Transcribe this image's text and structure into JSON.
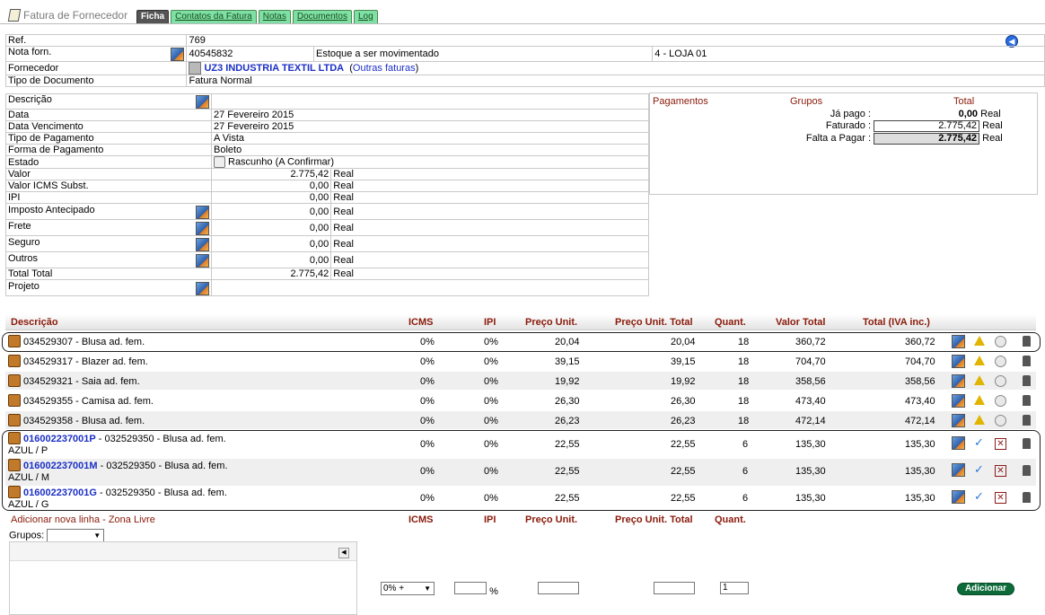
{
  "header": {
    "title": "Fatura de Fornecedor"
  },
  "tabs": [
    {
      "label": "Ficha",
      "active": true
    },
    {
      "label": "Contatos da Fatura",
      "active": false
    },
    {
      "label": "Notas",
      "active": false
    },
    {
      "label": "Documentos",
      "active": false
    },
    {
      "label": "Log",
      "active": false
    }
  ],
  "ficha": {
    "ref_label": "Ref.",
    "ref_value": "769",
    "nota_label": "Nota forn.",
    "nota_value": "40545832",
    "estoque_label": "Estoque a ser movimentado",
    "estoque_value": "4 - LOJA 01",
    "fornecedor_label": "Fornecedor",
    "fornecedor_name": "UZ3 INDUSTRIA TEXTIL LTDA",
    "fornecedor_link": "Outras faturas",
    "tipo_doc_label": "Tipo de Documento",
    "tipo_doc_value": "Fatura Normal",
    "descricao_label": "Descrição",
    "data_label": "Data",
    "data_value": "27 Fevereiro 2015",
    "venc_label": "Data Vencimento",
    "venc_value": "27 Fevereiro 2015",
    "tipo_pag_label": "Tipo de Pagamento",
    "tipo_pag_value": "A Vista",
    "forma_pag_label": "Forma de Pagamento",
    "forma_pag_value": "Boleto",
    "estado_label": "Estado",
    "estado_value": "Rascunho (A Confirmar)",
    "valor_label": "Valor",
    "valor_value": "2.775,42",
    "icms_label": "Valor ICMS Subst.",
    "icms_value": "0,00",
    "ipi_label": "IPI",
    "ipi_value": "0,00",
    "imposto_label": "Imposto Antecipado",
    "imposto_value": "0,00",
    "frete_label": "Frete",
    "frete_value": "0,00",
    "seguro_label": "Seguro",
    "seguro_value": "0,00",
    "outros_label": "Outros",
    "outros_value": "0,00",
    "total_label": "Total Total",
    "total_value": "2.775,42",
    "projeto_label": "Projeto",
    "currency": "Real"
  },
  "payments": {
    "col1": "Pagamentos",
    "col2": "Grupos",
    "col3": "Total",
    "ja_pago_label": "Já pago :",
    "ja_pago_value": "0,00",
    "faturado_label": "Faturado :",
    "faturado_value": "2.775,42",
    "falta_label": "Falta a Pagar :",
    "falta_value": "2.775,42",
    "currency": "Real"
  },
  "items_header": {
    "descricao": "Descrição",
    "icms": "ICMS",
    "ipi": "IPI",
    "preco": "Preço Unit.",
    "preco_total": "Preço Unit. Total",
    "quant": "Quant.",
    "valor_total": "Valor Total",
    "total_iva": "Total (IVA inc.)"
  },
  "items": [
    {
      "desc": "034529307 - Blusa ad. fem.",
      "icms": "0%",
      "ipi": "0%",
      "preco": "20,04",
      "preco_total": "20,04",
      "quant": "18",
      "valor": "360,72",
      "total": "360,72"
    },
    {
      "desc": "034529317 - Blazer ad. fem.",
      "icms": "0%",
      "ipi": "0%",
      "preco": "39,15",
      "preco_total": "39,15",
      "quant": "18",
      "valor": "704,70",
      "total": "704,70"
    },
    {
      "desc": "034529321 - Saia ad. fem.",
      "icms": "0%",
      "ipi": "0%",
      "preco": "19,92",
      "preco_total": "19,92",
      "quant": "18",
      "valor": "358,56",
      "total": "358,56"
    },
    {
      "desc": "034529355 - Camisa ad. fem.",
      "icms": "0%",
      "ipi": "0%",
      "preco": "26,30",
      "preco_total": "26,30",
      "quant": "18",
      "valor": "473,40",
      "total": "473,40"
    },
    {
      "desc": "034529358 - Blusa ad. fem.",
      "icms": "0%",
      "ipi": "0%",
      "preco": "26,23",
      "preco_total": "26,23",
      "quant": "18",
      "valor": "472,14",
      "total": "472,14"
    }
  ],
  "items2": [
    {
      "code": "016002237001P",
      "desc": " - 032529350 - Blusa ad. fem.",
      "variant": "AZUL / P",
      "icms": "0%",
      "ipi": "0%",
      "preco": "22,55",
      "preco_total": "22,55",
      "quant": "6",
      "valor": "135,30",
      "total": "135,30"
    },
    {
      "code": "016002237001M",
      "desc": " - 032529350 - Blusa ad. fem.",
      "variant": "AZUL / M",
      "icms": "0%",
      "ipi": "0%",
      "preco": "22,55",
      "preco_total": "22,55",
      "quant": "6",
      "valor": "135,30",
      "total": "135,30"
    },
    {
      "code": "016002237001G",
      "desc": " - 032529350 - Blusa ad. fem.",
      "variant": "AZUL / G",
      "icms": "0%",
      "ipi": "0%",
      "preco": "22,55",
      "preco_total": "22,55",
      "quant": "6",
      "valor": "135,30",
      "total": "135,30"
    }
  ],
  "add_line": {
    "title": "Adicionar nova linha - Zona Livre",
    "icms": "ICMS",
    "ipi": "IPI",
    "preco": "Preço Unit.",
    "preco_total": "Preço Unit. Total",
    "quant": "Quant.",
    "grupos_label": "Grupos:",
    "tax_select": "0% +",
    "percent": "%",
    "quant_value": "1",
    "button": "Adicionar"
  }
}
